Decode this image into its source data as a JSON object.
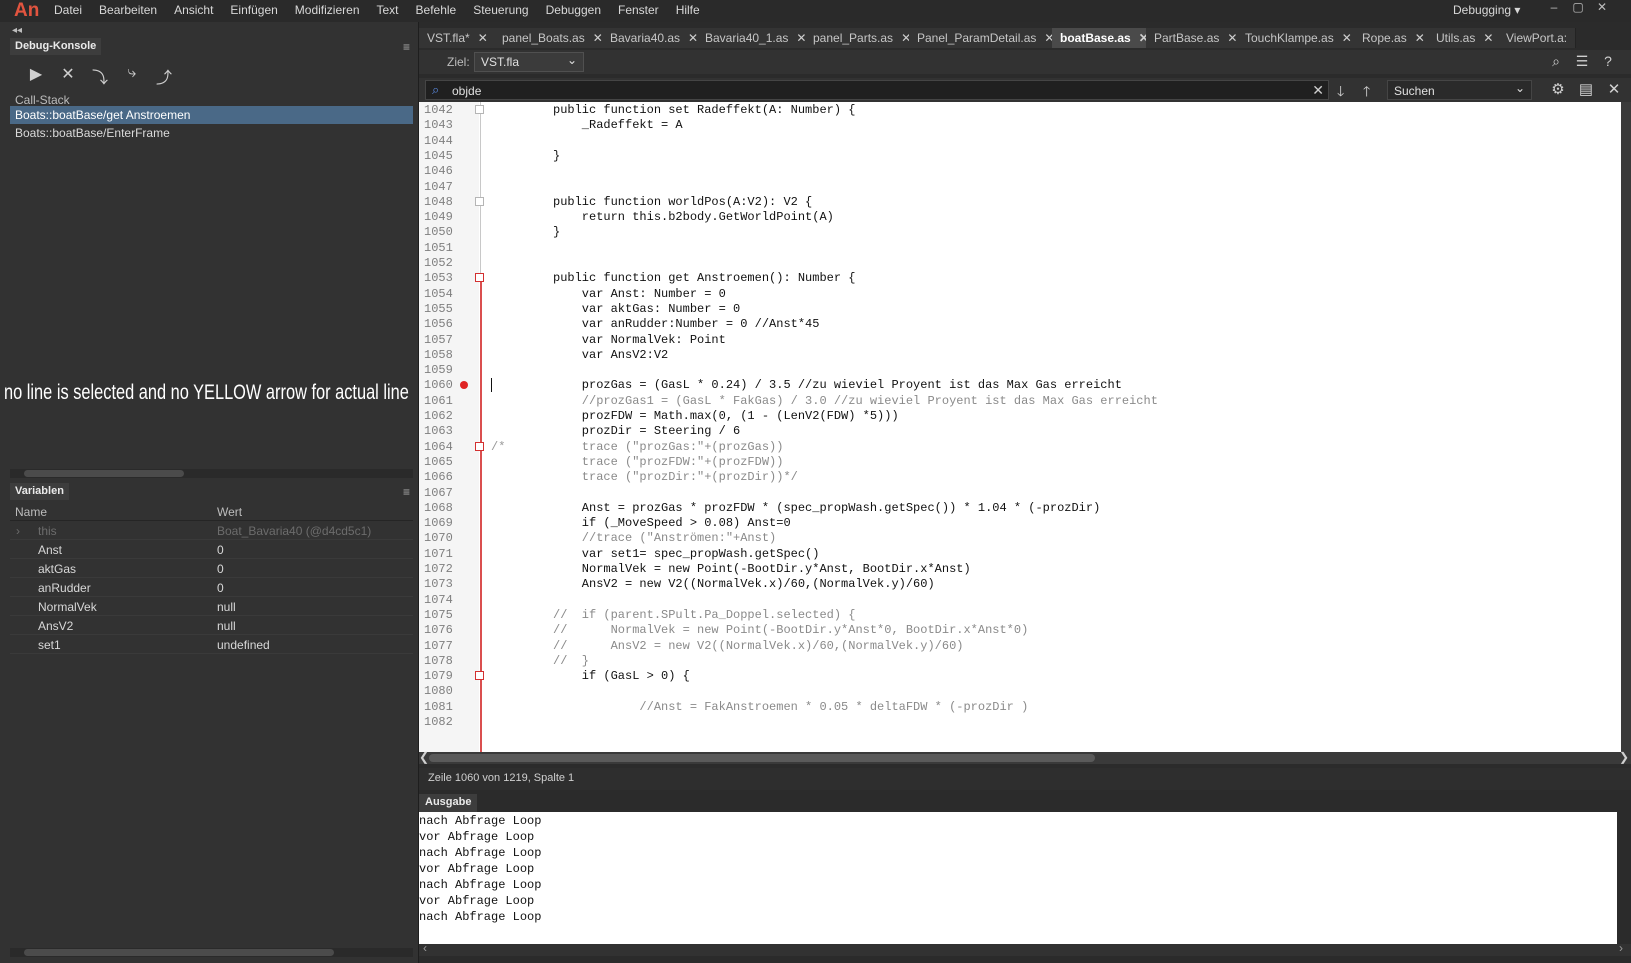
{
  "app": {
    "logo": "An",
    "menu": [
      "Datei",
      "Bearbeiten",
      "Ansicht",
      "Einfügen",
      "Modifizieren",
      "Text",
      "Befehle",
      "Steuerung",
      "Debuggen",
      "Fenster",
      "Hilfe"
    ],
    "workspace": "Debugging",
    "window_buttons": [
      "–",
      "▢",
      "✕"
    ]
  },
  "debug_console": {
    "tab_label": "Debug-Konsole",
    "toolbar": [
      "▶",
      "✕",
      "⤵",
      "⤷",
      "⤴"
    ],
    "call_stack_label": "Call-Stack",
    "call_stack": [
      "Boats::boatBase/get Anstroemen",
      "Boats::boatBase/EnterFrame"
    ]
  },
  "variables": {
    "tab_label": "Variablen",
    "col_name": "Name",
    "col_value": "Wert",
    "rows": [
      {
        "name": "this",
        "value": "Boat_Bavaria40 (@d4cd5c1)",
        "expandable": "›",
        "dim": true
      },
      {
        "name": "Anst",
        "value": "0"
      },
      {
        "name": "aktGas",
        "value": "0"
      },
      {
        "name": "anRudder",
        "value": "0"
      },
      {
        "name": "NormalVek",
        "value": "null"
      },
      {
        "name": "AnsV2",
        "value": "null"
      },
      {
        "name": "set1",
        "value": "undefined"
      }
    ]
  },
  "annotation": "no line is selected and no YELLOW arrow for actual line",
  "tabs": [
    "VST.fla*",
    "panel_Boats.as",
    "Bavaria40.as",
    "Bavaria40_1.as",
    "panel_Parts.as",
    "Panel_ParamDetail.as",
    "boatBase.as",
    "PartBase.as",
    "TouchKlampe.as",
    "Rope.as",
    "Utils.as",
    "ViewPort.a:"
  ],
  "active_tab": "boatBase.as",
  "tab_close": "✕",
  "target": {
    "label": "Ziel:",
    "value": "VST.fla",
    "arrow": "⌄"
  },
  "search": {
    "value": "objde",
    "mode": "Suchen",
    "clear": "✕",
    "down": "🡓",
    "up": "🡑",
    "mode_arrow": "⌄"
  },
  "code_lines": [
    {
      "n": "1042",
      "code": "public function set Radeffekt(A: Number) {"
    },
    {
      "n": "1043",
      "code": "    _Radeffekt = A"
    },
    {
      "n": "1044",
      "code": ""
    },
    {
      "n": "1045",
      "code": "}"
    },
    {
      "n": "1046",
      "code": ""
    },
    {
      "n": "1047",
      "code": ""
    },
    {
      "n": "1048",
      "code": "public function worldPos(A:V2): V2 {"
    },
    {
      "n": "1049",
      "code": "    return this.b2body.GetWorldPoint(A)"
    },
    {
      "n": "1050",
      "code": "}"
    },
    {
      "n": "1051",
      "code": ""
    },
    {
      "n": "1052",
      "code": ""
    },
    {
      "n": "1053",
      "code": "public function get Anstroemen(): Number {"
    },
    {
      "n": "1054",
      "code": "    var Anst: Number = 0"
    },
    {
      "n": "1055",
      "code": "    var aktGas: Number = 0"
    },
    {
      "n": "1056",
      "code": "    var anRudder:Number = 0 //Anst*45"
    },
    {
      "n": "1057",
      "code": "    var NormalVek: Point"
    },
    {
      "n": "1058",
      "code": "    var AnsV2:V2"
    },
    {
      "n": "1059",
      "code": ""
    },
    {
      "n": "1060",
      "code": "    prozGas = (GasL * 0.24) / 3.5 //zu wieviel Proyent ist das Max Gas erreicht"
    },
    {
      "n": "1061",
      "code": "    //prozGas1 = (GasL * FakGas) / 3.0 //zu wieviel Proyent ist das Max Gas erreicht"
    },
    {
      "n": "1062",
      "code": "    prozFDW = Math.max(0, (1 - (LenV2(FDW) *5)))"
    },
    {
      "n": "1063",
      "code": "    prozDir = Steering / 6"
    },
    {
      "n": "1064",
      "code": "    trace (\"prozGas:\"+(prozGas))"
    },
    {
      "n": "1065",
      "code": "    trace (\"prozFDW:\"+(prozFDW))"
    },
    {
      "n": "1066",
      "code": "    trace (\"prozDir:\"+(prozDir))*/"
    },
    {
      "n": "1067",
      "code": ""
    },
    {
      "n": "1068",
      "code": "    Anst = prozGas * prozFDW * (spec_propWash.getSpec()) * 1.04 * (-prozDir)"
    },
    {
      "n": "1069",
      "code": "    if (_MoveSpeed > 0.08) Anst=0"
    },
    {
      "n": "1070",
      "code": "    //trace (\"Anströmen:\"+Anst)"
    },
    {
      "n": "1071",
      "code": "    var set1= spec_propWash.getSpec()"
    },
    {
      "n": "1072",
      "code": "    NormalVek = new Point(-BootDir.y*Anst, BootDir.x*Anst)"
    },
    {
      "n": "1073",
      "code": "    AnsV2 = new V2((NormalVek.x)/60,(NormalVek.y)/60)"
    },
    {
      "n": "1074",
      "code": ""
    },
    {
      "n": "1075",
      "code": "//  if (parent.SPult.Pa_Doppel.selected) {"
    },
    {
      "n": "1076",
      "code": "//      NormalVek = new Point(-BootDir.y*Anst*0, BootDir.x*Anst*0)"
    },
    {
      "n": "1077",
      "code": "//      AnsV2 = new V2((NormalVek.x)/60,(NormalVek.y)/60)"
    },
    {
      "n": "1078",
      "code": "//  }"
    },
    {
      "n": "1079",
      "code": "    if (GasL > 0) {"
    },
    {
      "n": "1080",
      "code": ""
    },
    {
      "n": "1081",
      "code": "            //Anst = FakAnstroemen * 0.05 * deltaFDW * (-prozDir )"
    },
    {
      "n": "1082",
      "code": ""
    }
  ],
  "comment_open": "/*",
  "status": "Zeile 1060 von 1219, Spalte 1",
  "output": {
    "tab_label": "Ausgabe",
    "lines": [
      "nach Abfrage Loop",
      "vor Abfrage Loop",
      "nach Abfrage Loop",
      "vor Abfrage Loop",
      "nach Abfrage Loop",
      "vor Abfrage Loop",
      "nach Abfrage Loop"
    ]
  }
}
